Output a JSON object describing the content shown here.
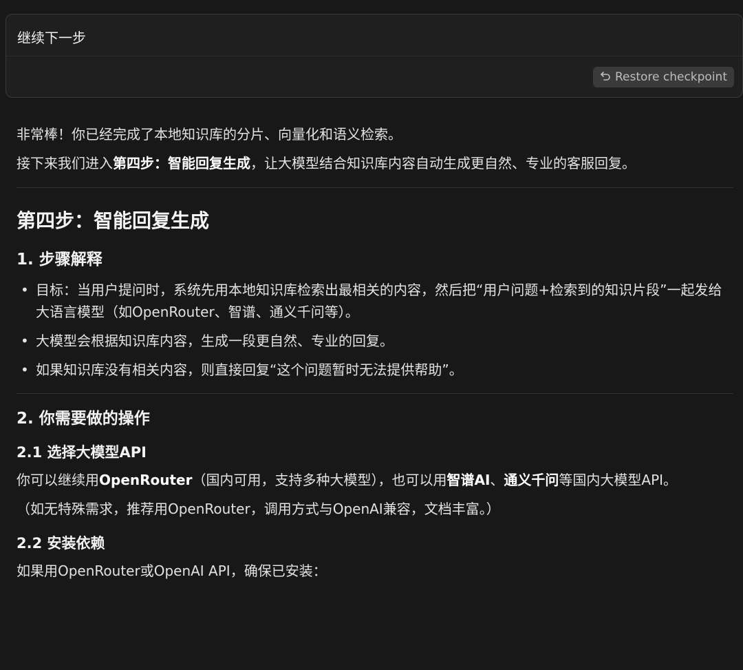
{
  "user_message": "继续下一步",
  "restore_button": {
    "label": "Restore checkpoint",
    "icon": "undo-icon"
  },
  "intro": {
    "line1": "非常棒！你已经完成了本地知识库的分片、向量化和语义检索。",
    "line2_prefix": "接下来我们进入",
    "line2_bold": "第四步：智能回复生成",
    "line2_suffix": "，让大模型结合知识库内容自动生成更自然、专业的客服回复。"
  },
  "section_title": "第四步：智能回复生成",
  "step1": {
    "heading": "1. 步骤解释",
    "bullets": [
      "目标：当用户提问时，系统先用本地知识库检索出最相关的内容，然后把“用户问题+检索到的知识片段”一起发给大语言模型（如OpenRouter、智谱、通义千问等）。",
      "大模型会根据知识库内容，生成一段更自然、专业的回复。",
      "如果知识库没有相关内容，则直接回复“这个问题暂时无法提供帮助”。"
    ]
  },
  "step2": {
    "heading": "2. 你需要做的操作",
    "sub1": {
      "heading": "2.1 选择大模型API",
      "para_t1": "你可以继续用",
      "para_b1": "OpenRouter",
      "para_t2": "（国内可用，支持多种大模型），也可以用",
      "para_b2": "智谱AI",
      "para_t3": "、",
      "para_b3": "通义千问",
      "para_t4": "等国内大模型API。",
      "note": "（如无特殊需求，推荐用OpenRouter，调用方式与OpenAI兼容，文档丰富。）"
    },
    "sub2": {
      "heading": "2.2 安装依赖",
      "para": "如果用OpenRouter或OpenAI API，确保已安装："
    }
  }
}
